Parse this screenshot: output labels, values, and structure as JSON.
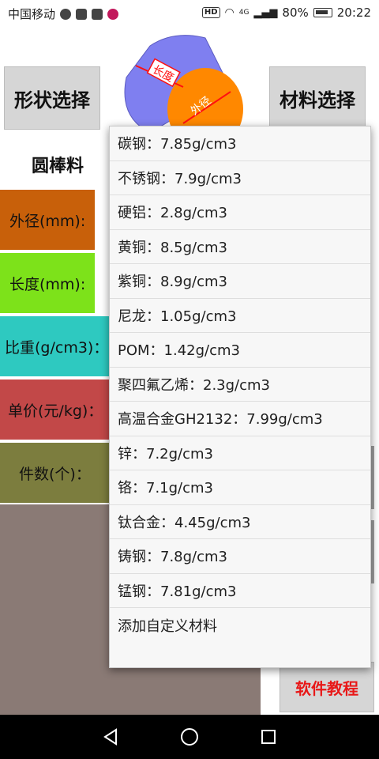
{
  "status_bar": {
    "carrier": "中国移动",
    "hd": "HD",
    "network": "4G",
    "battery": "80%",
    "time": "20:22"
  },
  "buttons": {
    "shape_select": "形状选择",
    "material_select": "材料选择",
    "tutorial": "软件教程"
  },
  "diagram": {
    "length_label": "长度",
    "diameter_label": "外径"
  },
  "shape_name": "圆棒料",
  "fields": {
    "outer_diameter": "外径(mm):",
    "length": "长度(mm):",
    "specific_gravity": "比重(g/cm3)：",
    "unit_price": "单价(元/kg)：",
    "count": "件数(个)："
  },
  "material_menu": {
    "items": [
      "碳钢：7.85g/cm3",
      "不锈钢：7.9g/cm3",
      "硬铝：2.8g/cm3",
      "黄铜：8.5g/cm3",
      "紫铜：8.9g/cm3",
      "尼龙：1.05g/cm3",
      "POM：1.42g/cm3",
      "聚四氟乙烯：2.3g/cm3",
      "高温合金GH2132：7.99g/cm3",
      "锌：7.2g/cm3",
      "铬：7.1g/cm3",
      "钛合金：4.45g/cm3",
      "铸钢：7.8g/cm3",
      "锰钢：7.81g/cm3",
      "添加自定义材料"
    ]
  },
  "colors": {
    "outer_diameter_row": "#c8600a",
    "length_row": "#7de21a",
    "specific_gravity_row": "#2ec9c0",
    "unit_price_row": "#c24848",
    "count_row": "#7c7d3e",
    "result_area": "#8a7a75",
    "tutorial_text": "#e81818",
    "cylinder_side": "#7f7ff0",
    "cylinder_end": "#ff8800"
  },
  "icons": {
    "nav_back": "back-triangle-icon",
    "nav_home": "home-circle-icon",
    "nav_recent": "recent-square-icon"
  }
}
